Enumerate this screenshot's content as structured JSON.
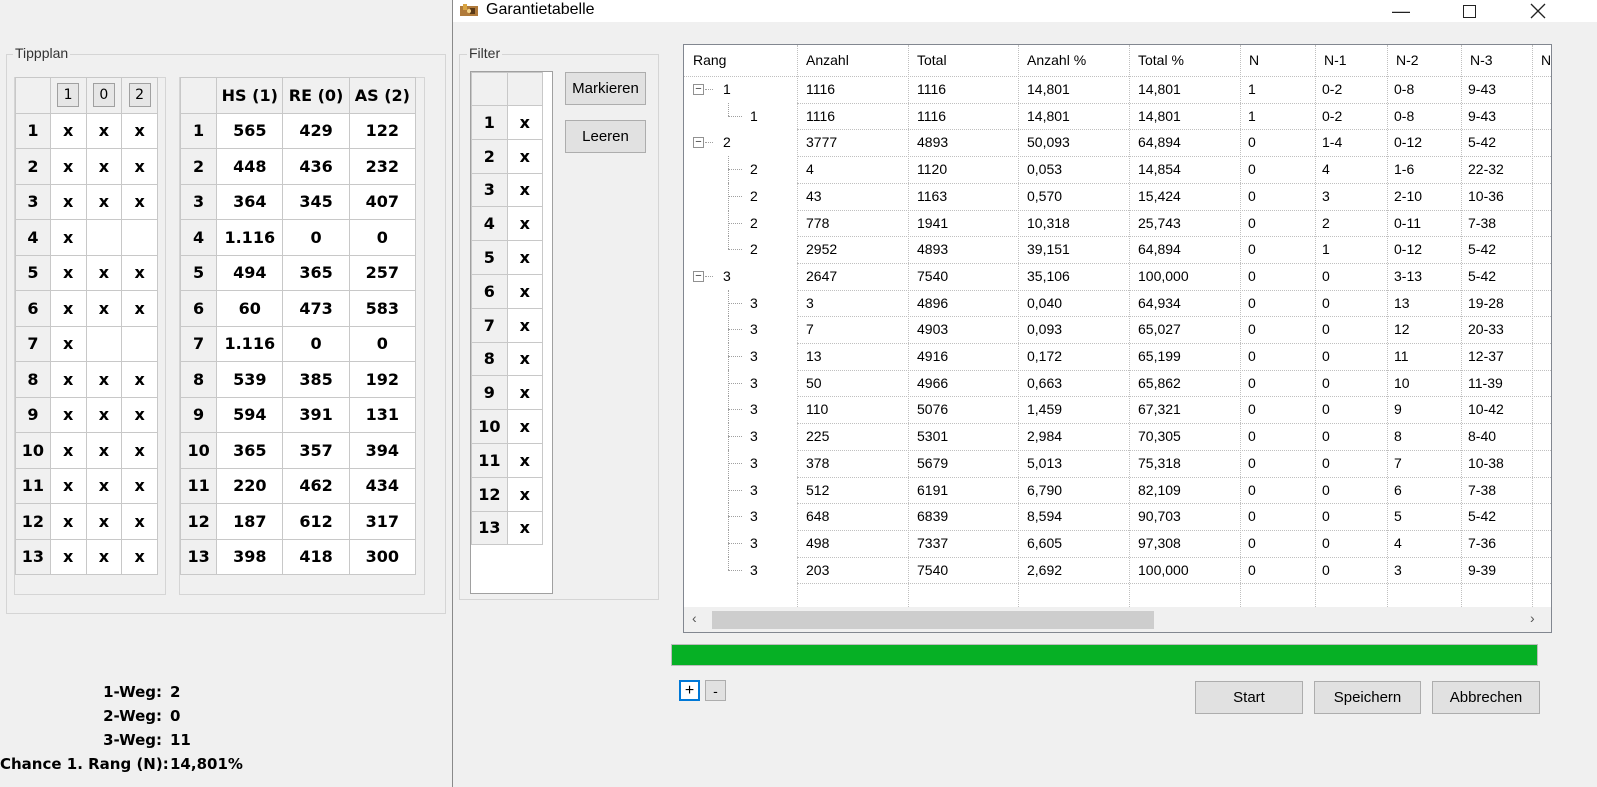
{
  "tippplan": {
    "label": "Tippplan",
    "headers": [
      "1",
      "0",
      "2"
    ],
    "rows": [
      [
        "1",
        "x",
        "x",
        "x"
      ],
      [
        "2",
        "x",
        "x",
        "x"
      ],
      [
        "3",
        "x",
        "x",
        "x"
      ],
      [
        "4",
        "x",
        "",
        ""
      ],
      [
        "5",
        "x",
        "x",
        "x"
      ],
      [
        "6",
        "x",
        "x",
        "x"
      ],
      [
        "7",
        "x",
        "",
        ""
      ],
      [
        "8",
        "x",
        "x",
        "x"
      ],
      [
        "9",
        "x",
        "x",
        "x"
      ],
      [
        "10",
        "x",
        "x",
        "x"
      ],
      [
        "11",
        "x",
        "x",
        "x"
      ],
      [
        "12",
        "x",
        "x",
        "x"
      ],
      [
        "13",
        "x",
        "x",
        "x"
      ]
    ],
    "stats_headers": [
      "HS (1)",
      "RE (0)",
      "AS (2)"
    ],
    "stats_rows": [
      [
        "1",
        "565",
        "429",
        "122"
      ],
      [
        "2",
        "448",
        "436",
        "232"
      ],
      [
        "3",
        "364",
        "345",
        "407"
      ],
      [
        "4",
        "1.116",
        "0",
        "0"
      ],
      [
        "5",
        "494",
        "365",
        "257"
      ],
      [
        "6",
        "60",
        "473",
        "583"
      ],
      [
        "7",
        "1.116",
        "0",
        "0"
      ],
      [
        "8",
        "539",
        "385",
        "192"
      ],
      [
        "9",
        "594",
        "391",
        "131"
      ],
      [
        "10",
        "365",
        "357",
        "394"
      ],
      [
        "11",
        "220",
        "462",
        "434"
      ],
      [
        "12",
        "187",
        "612",
        "317"
      ],
      [
        "13",
        "398",
        "418",
        "300"
      ]
    ],
    "summary": [
      {
        "label": "1-Weg:",
        "value": "2"
      },
      {
        "label": "2-Weg:",
        "value": "0"
      },
      {
        "label": "3-Weg:",
        "value": "11"
      },
      {
        "label": "Chance 1. Rang (N):",
        "value": "14,801%"
      }
    ]
  },
  "dialog": {
    "title": "Garantietabelle",
    "filter_label": "Filter",
    "filter_rows": [
      [
        "1",
        "x"
      ],
      [
        "2",
        "x"
      ],
      [
        "3",
        "x"
      ],
      [
        "4",
        "x"
      ],
      [
        "5",
        "x"
      ],
      [
        "6",
        "x"
      ],
      [
        "7",
        "x"
      ],
      [
        "8",
        "x"
      ],
      [
        "9",
        "x"
      ],
      [
        "10",
        "x"
      ],
      [
        "11",
        "x"
      ],
      [
        "12",
        "x"
      ],
      [
        "13",
        "x"
      ]
    ],
    "mark_button": "Markieren",
    "clear_button": "Leeren",
    "columns": [
      "Rang",
      "Anzahl",
      "Total",
      "Anzahl %",
      "Total %",
      "N",
      "N-1",
      "N-2",
      "N-3",
      "N"
    ],
    "rows": [
      {
        "level": 0,
        "expander": "−",
        "cells": [
          "1",
          "1116",
          "1116",
          "14,801",
          "14,801",
          "1",
          "0-2",
          "0-8",
          "9-43"
        ]
      },
      {
        "level": 1,
        "last": true,
        "cells": [
          "1",
          "1116",
          "1116",
          "14,801",
          "14,801",
          "1",
          "0-2",
          "0-8",
          "9-43"
        ]
      },
      {
        "level": 0,
        "expander": "−",
        "cells": [
          "2",
          "3777",
          "4893",
          "50,093",
          "64,894",
          "0",
          "1-4",
          "0-12",
          "5-42"
        ]
      },
      {
        "level": 1,
        "cells": [
          "2",
          "4",
          "1120",
          "0,053",
          "14,854",
          "0",
          "4",
          "1-6",
          "22-32"
        ]
      },
      {
        "level": 1,
        "cells": [
          "2",
          "43",
          "1163",
          "0,570",
          "15,424",
          "0",
          "3",
          "2-10",
          "10-36"
        ]
      },
      {
        "level": 1,
        "cells": [
          "2",
          "778",
          "1941",
          "10,318",
          "25,743",
          "0",
          "2",
          "0-11",
          "7-38"
        ]
      },
      {
        "level": 1,
        "last": true,
        "cells": [
          "2",
          "2952",
          "4893",
          "39,151",
          "64,894",
          "0",
          "1",
          "0-12",
          "5-42"
        ]
      },
      {
        "level": 0,
        "expander": "−",
        "cells": [
          "3",
          "2647",
          "7540",
          "35,106",
          "100,000",
          "0",
          "0",
          "3-13",
          "5-42"
        ]
      },
      {
        "level": 1,
        "cells": [
          "3",
          "3",
          "4896",
          "0,040",
          "64,934",
          "0",
          "0",
          "13",
          "19-28"
        ]
      },
      {
        "level": 1,
        "cells": [
          "3",
          "7",
          "4903",
          "0,093",
          "65,027",
          "0",
          "0",
          "12",
          "20-33"
        ]
      },
      {
        "level": 1,
        "cells": [
          "3",
          "13",
          "4916",
          "0,172",
          "65,199",
          "0",
          "0",
          "11",
          "12-37"
        ]
      },
      {
        "level": 1,
        "cells": [
          "3",
          "50",
          "4966",
          "0,663",
          "65,862",
          "0",
          "0",
          "10",
          "11-39"
        ]
      },
      {
        "level": 1,
        "cells": [
          "3",
          "110",
          "5076",
          "1,459",
          "67,321",
          "0",
          "0",
          "9",
          "10-42"
        ]
      },
      {
        "level": 1,
        "cells": [
          "3",
          "225",
          "5301",
          "2,984",
          "70,305",
          "0",
          "0",
          "8",
          "8-40"
        ]
      },
      {
        "level": 1,
        "cells": [
          "3",
          "378",
          "5679",
          "5,013",
          "75,318",
          "0",
          "0",
          "7",
          "10-38"
        ]
      },
      {
        "level": 1,
        "cells": [
          "3",
          "512",
          "6191",
          "6,790",
          "82,109",
          "0",
          "0",
          "6",
          "7-38"
        ]
      },
      {
        "level": 1,
        "cells": [
          "3",
          "648",
          "6839",
          "8,594",
          "90,703",
          "0",
          "0",
          "5",
          "5-42"
        ]
      },
      {
        "level": 1,
        "cells": [
          "3",
          "498",
          "7337",
          "6,605",
          "97,308",
          "0",
          "0",
          "4",
          "7-36"
        ]
      },
      {
        "level": 1,
        "last": true,
        "cells": [
          "3",
          "203",
          "7540",
          "2,692",
          "100,000",
          "0",
          "0",
          "3",
          "9-39"
        ]
      }
    ],
    "progress": 1.0,
    "progress_color": "#06b025",
    "expand_all": "+",
    "collapse_all": "-",
    "start_button": "Start",
    "save_button": "Speichern",
    "cancel_button": "Abbrechen"
  }
}
